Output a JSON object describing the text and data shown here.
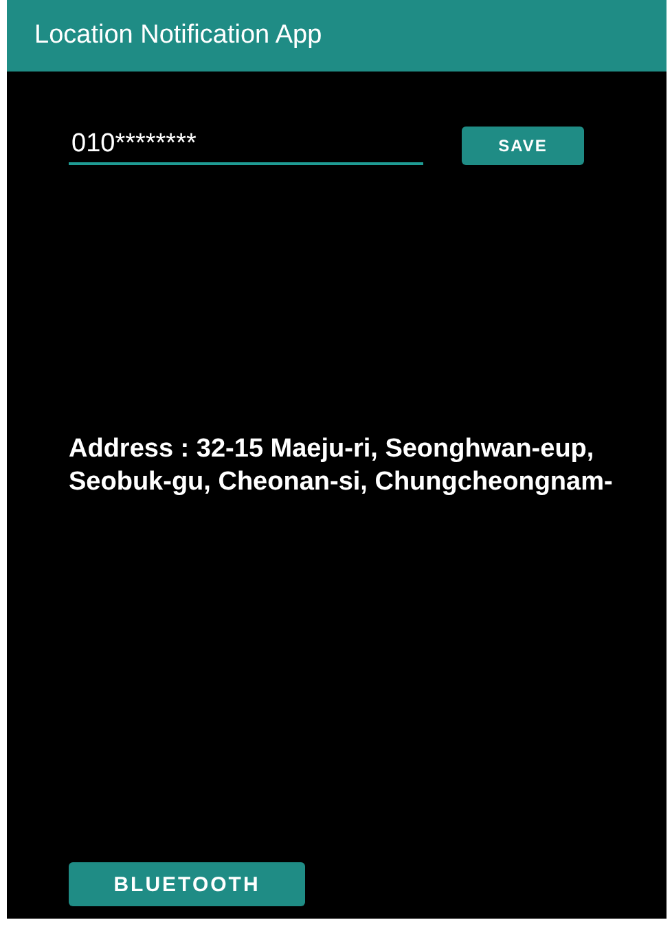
{
  "app_bar": {
    "title": "Location Notification App"
  },
  "phone_field": {
    "value": "010********"
  },
  "save_button": {
    "label": "SAVE"
  },
  "address": {
    "text": "Address : 32-15 Maeju-ri, Seonghwan-eup, Seobuk-gu, Cheonan-si, Chungcheongnam-"
  },
  "bluetooth_button": {
    "label": "BLUETOOTH"
  }
}
